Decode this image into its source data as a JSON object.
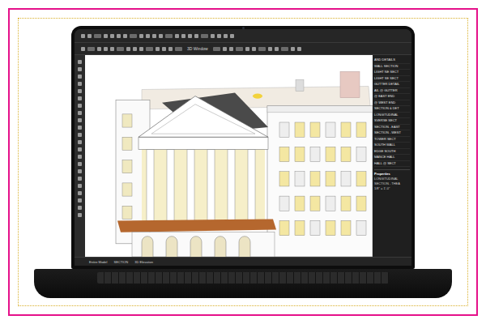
{
  "toolbar": {
    "view_label": "3D Window"
  },
  "resource_list": {
    "items": [
      "AND DETAILS",
      "WALL SECTION",
      "LIGHT NE SECT",
      "LIGHT SE SECT",
      "GUTTER DETAIL",
      "AIL @ GUTTER",
      "@ EAST END",
      "@ WEST END",
      "SECTION & DET",
      "LONGITUDINAL",
      "SVERSE SECT",
      "SECTION - EAST",
      "SECTION - WEST",
      "TOWER SECT",
      "SOUTH WALL",
      "EDGE SOUTH",
      "MANCE HALL",
      "HALL @ SECT"
    ]
  },
  "properties": {
    "title": "Properties",
    "lines": [
      "LONGITUDINAL",
      "SECTION - THEA",
      "1/8\" = 1'-0\""
    ]
  },
  "status_bar": {
    "items": [
      "Entire Model",
      "SECTION",
      "3D Elevation"
    ]
  }
}
